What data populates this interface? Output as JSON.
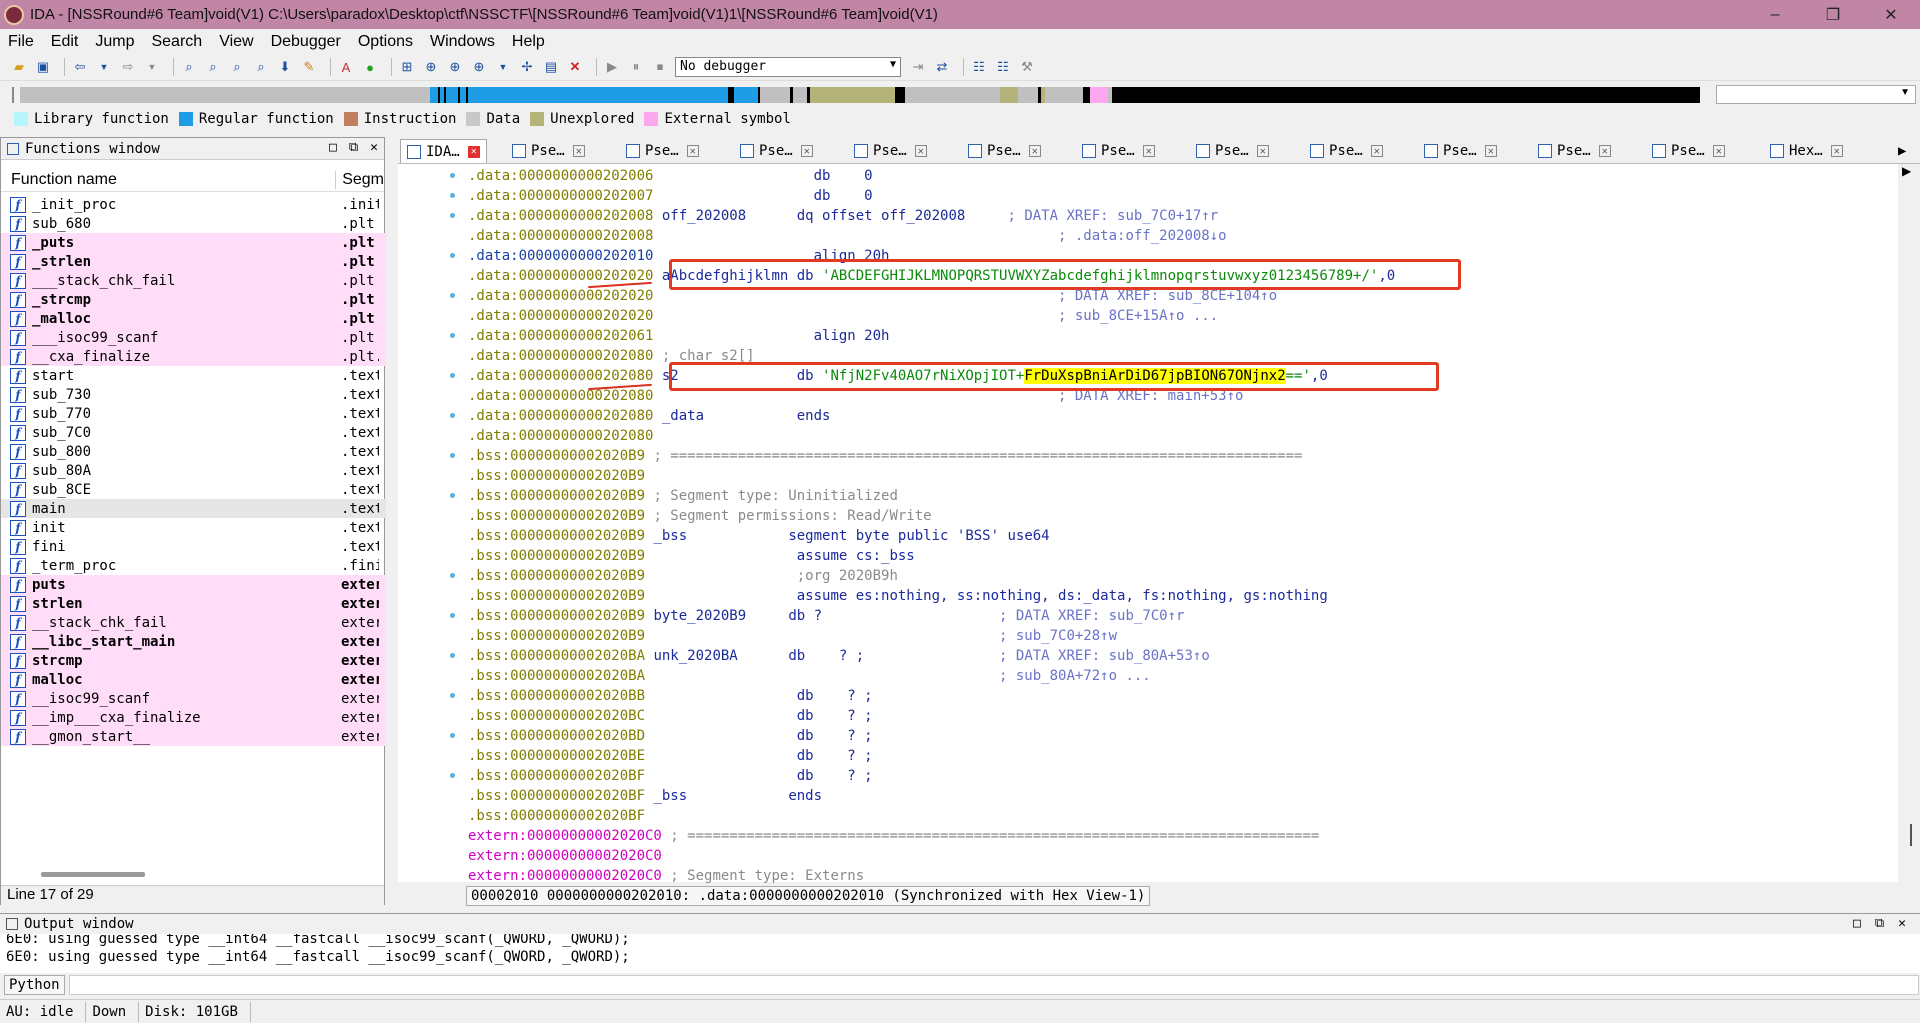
{
  "window": {
    "title": "IDA - [NSSRound#6 Team]void(V1) C:\\Users\\paradox\\Desktop\\ctf\\NSSCTF\\[NSSRound#6 Team]void(V1)1\\[NSSRound#6 Team]void(V1)",
    "controls": [
      "–",
      "❐",
      "✕"
    ]
  },
  "menu": [
    "File",
    "Edit",
    "Jump",
    "Search",
    "View",
    "Debugger",
    "Options",
    "Windows",
    "Help"
  ],
  "toolbar": {
    "debugger_value": "No debugger"
  },
  "legend": [
    {
      "label": "Library function",
      "color": "#b8f4fc"
    },
    {
      "label": "Regular function",
      "color": "#1e9de6"
    },
    {
      "label": "Instruction",
      "color": "#c08060"
    },
    {
      "label": "Data",
      "color": "#c8c8c8"
    },
    {
      "label": "Unexplored",
      "color": "#b4b47a"
    },
    {
      "label": "External symbol",
      "color": "#fca8f0"
    }
  ],
  "functions_window": {
    "title": "Functions window",
    "col_name": "Function name",
    "col_segment": "Segm",
    "line_info": "Line 17 of 29",
    "items": [
      {
        "name": "_init_proc",
        "seg": ".init",
        "style": ""
      },
      {
        "name": "sub_680",
        "seg": ".plt",
        "style": ""
      },
      {
        "name": "_puts",
        "seg": ".plt",
        "style": "ext bold"
      },
      {
        "name": "_strlen",
        "seg": ".plt",
        "style": "ext bold"
      },
      {
        "name": "___stack_chk_fail",
        "seg": ".plt",
        "style": "ext"
      },
      {
        "name": "_strcmp",
        "seg": ".plt",
        "style": "ext bold"
      },
      {
        "name": "_malloc",
        "seg": ".plt",
        "style": "ext bold"
      },
      {
        "name": "___isoc99_scanf",
        "seg": ".plt",
        "style": "ext"
      },
      {
        "name": "__cxa_finalize",
        "seg": ".plt.",
        "style": "ext"
      },
      {
        "name": "start",
        "seg": ".text",
        "style": ""
      },
      {
        "name": "sub_730",
        "seg": ".text",
        "style": ""
      },
      {
        "name": "sub_770",
        "seg": ".text",
        "style": ""
      },
      {
        "name": "sub_7C0",
        "seg": ".text",
        "style": ""
      },
      {
        "name": "sub_800",
        "seg": ".text",
        "style": ""
      },
      {
        "name": "sub_80A",
        "seg": ".text",
        "style": ""
      },
      {
        "name": "sub_8CE",
        "seg": ".text",
        "style": ""
      },
      {
        "name": "main",
        "seg": ".text",
        "style": "sel"
      },
      {
        "name": "init",
        "seg": ".text",
        "style": ""
      },
      {
        "name": "fini",
        "seg": ".text",
        "style": ""
      },
      {
        "name": "_term_proc",
        "seg": ".fini",
        "style": ""
      },
      {
        "name": "puts",
        "seg": "exter",
        "style": "ext bold"
      },
      {
        "name": "strlen",
        "seg": "exter",
        "style": "ext bold"
      },
      {
        "name": "__stack_chk_fail",
        "seg": "exter",
        "style": "ext"
      },
      {
        "name": "__libc_start_main",
        "seg": "exter",
        "style": "ext bold"
      },
      {
        "name": "strcmp",
        "seg": "exter",
        "style": "ext bold"
      },
      {
        "name": "malloc",
        "seg": "exter",
        "style": "ext bold"
      },
      {
        "name": "__isoc99_scanf",
        "seg": "exter",
        "style": "ext"
      },
      {
        "name": "__imp___cxa_finalize",
        "seg": "exter",
        "style": "ext"
      },
      {
        "name": "__gmon_start__",
        "seg": "exter",
        "style": "ext"
      }
    ]
  },
  "tabs": [
    "IDA…",
    "Pse…",
    "Pse…",
    "Pse…",
    "Pse…",
    "Pse…",
    "Pse…",
    "Pse…",
    "Pse…",
    "Pse…",
    "Pse…",
    "Pse…",
    "Hex…"
  ],
  "code_lines": [
    {
      "addr": ".data:0000000000202006",
      "seg": "data",
      "parts": [
        [
          "",
          "                   "
        ],
        [
          "kw",
          "db    0"
        ]
      ]
    },
    {
      "addr": ".data:0000000000202007",
      "seg": "data",
      "parts": [
        [
          "",
          "                   "
        ],
        [
          "kw",
          "db    0"
        ]
      ]
    },
    {
      "addr": ".data:0000000000202008",
      "seg": "data",
      "parts": [
        [
          "nm",
          " off_202008      "
        ],
        [
          "kw",
          "dq offset off_202008"
        ],
        [
          "cm",
          "     ; DATA XREF: sub_7C0+17↑r"
        ]
      ]
    },
    {
      "addr": ".data:0000000000202008",
      "seg": "data",
      "parts": [
        [
          "cm",
          "                                                ; .data:off_202008↓o"
        ]
      ]
    },
    {
      "addr": ".data:0000000000202010",
      "seg": "datahi",
      "parts": [
        [
          "",
          "                   "
        ],
        [
          "kw",
          "align 20h"
        ]
      ]
    },
    {
      "addr": ".data:0000000000202020",
      "seg": "data",
      "parts": [
        [
          "nm",
          " aAbcdefghijklmn "
        ],
        [
          "kw",
          "db "
        ],
        [
          "str",
          "'ABCDEFGHIJKLMNOPQRSTUVWXYZabcdefghijklmnopqrstuvwxyz0123456789+/'"
        ],
        [
          "kw",
          ",0"
        ]
      ]
    },
    {
      "addr": ".data:0000000000202020",
      "seg": "data",
      "parts": [
        [
          "cm",
          "                                                ; DATA XREF: sub_8CE+104↑o"
        ]
      ]
    },
    {
      "addr": ".data:0000000000202020",
      "seg": "data",
      "parts": [
        [
          "cm",
          "                                                ; sub_8CE+15A↑o ..."
        ]
      ]
    },
    {
      "addr": ".data:0000000000202061",
      "seg": "data",
      "parts": [
        [
          "",
          "                   "
        ],
        [
          "kw",
          "align 20h"
        ]
      ]
    },
    {
      "addr": ".data:0000000000202080",
      "seg": "data",
      "parts": [
        [
          "gr",
          " ; char s2[]"
        ]
      ]
    },
    {
      "addr": ".data:0000000000202080",
      "seg": "data",
      "parts": [
        [
          "nm",
          " s2              "
        ],
        [
          "kw",
          "db "
        ],
        [
          "str",
          "'NfjN2Fv40AO7rNiXOpjIOT+"
        ],
        [
          "hl",
          "FrDuXspBniArDiD67jpBION67ONjnx2"
        ],
        [
          "str",
          "=='"
        ],
        [
          "kw",
          ",0"
        ]
      ]
    },
    {
      "addr": ".data:0000000000202080",
      "seg": "data",
      "parts": [
        [
          "cm",
          "                                                ; DATA XREF: main+53↑o"
        ]
      ]
    },
    {
      "addr": ".data:0000000000202080",
      "seg": "data",
      "parts": [
        [
          "nm",
          " _data           "
        ],
        [
          "kw",
          "ends"
        ]
      ]
    },
    {
      "addr": ".data:0000000000202080",
      "seg": "data",
      "parts": []
    },
    {
      "addr": ".bss:00000000002020B9",
      "seg": "data",
      "parts": [
        [
          "gr",
          " ; ==========================================================================="
        ]
      ]
    },
    {
      "addr": ".bss:00000000002020B9",
      "seg": "data",
      "parts": []
    },
    {
      "addr": ".bss:00000000002020B9",
      "seg": "data",
      "parts": [
        [
          "gr",
          " ; Segment type: Uninitialized"
        ]
      ]
    },
    {
      "addr": ".bss:00000000002020B9",
      "seg": "data",
      "parts": [
        [
          "gr",
          " ; Segment permissions: Read/Write"
        ]
      ]
    },
    {
      "addr": ".bss:00000000002020B9",
      "seg": "data",
      "parts": [
        [
          "nm",
          " _bss            "
        ],
        [
          "kw",
          "segment byte public 'BSS' use64"
        ]
      ]
    },
    {
      "addr": ".bss:00000000002020B9",
      "seg": "data",
      "parts": [
        [
          "",
          "                  "
        ],
        [
          "kw",
          "assume cs:_bss"
        ]
      ]
    },
    {
      "addr": ".bss:00000000002020B9",
      "seg": "data",
      "parts": [
        [
          "gr",
          "                  ;org 2020B9h"
        ]
      ]
    },
    {
      "addr": ".bss:00000000002020B9",
      "seg": "data",
      "parts": [
        [
          "",
          "                  "
        ],
        [
          "kw",
          "assume es:nothing, ss:nothing, ds:_data, fs:nothing, gs:nothing"
        ]
      ]
    },
    {
      "addr": ".bss:00000000002020B9",
      "seg": "data",
      "parts": [
        [
          "nm",
          " byte_2020B9     "
        ],
        [
          "kw",
          "db ?"
        ],
        [
          "cm",
          "                     ; DATA XREF: sub_7C0↑r"
        ]
      ]
    },
    {
      "addr": ".bss:00000000002020B9",
      "seg": "data",
      "parts": [
        [
          "cm",
          "                                          ; sub_7C0+28↑w"
        ]
      ]
    },
    {
      "addr": ".bss:00000000002020BA",
      "seg": "data",
      "parts": [
        [
          "nm",
          " unk_2020BA      "
        ],
        [
          "kw",
          "db    ? ;"
        ],
        [
          "cm",
          "                ; DATA XREF: sub_80A+53↑o"
        ]
      ]
    },
    {
      "addr": ".bss:00000000002020BA",
      "seg": "data",
      "parts": [
        [
          "cm",
          "                                          ; sub_80A+72↑o ..."
        ]
      ]
    },
    {
      "addr": ".bss:00000000002020BB",
      "seg": "data",
      "parts": [
        [
          "",
          "                  "
        ],
        [
          "kw",
          "db    ? ;"
        ]
      ]
    },
    {
      "addr": ".bss:00000000002020BC",
      "seg": "data",
      "parts": [
        [
          "",
          "                  "
        ],
        [
          "kw",
          "db    ? ;"
        ]
      ]
    },
    {
      "addr": ".bss:00000000002020BD",
      "seg": "data",
      "parts": [
        [
          "",
          "                  "
        ],
        [
          "kw",
          "db    ? ;"
        ]
      ]
    },
    {
      "addr": ".bss:00000000002020BE",
      "seg": "data",
      "parts": [
        [
          "",
          "                  "
        ],
        [
          "kw",
          "db    ? ;"
        ]
      ]
    },
    {
      "addr": ".bss:00000000002020BF",
      "seg": "data",
      "parts": [
        [
          "",
          "                  "
        ],
        [
          "kw",
          "db    ? ;"
        ]
      ]
    },
    {
      "addr": ".bss:00000000002020BF",
      "seg": "data",
      "parts": [
        [
          "nm",
          " _bss            "
        ],
        [
          "kw",
          "ends"
        ]
      ]
    },
    {
      "addr": ".bss:00000000002020BF",
      "seg": "data",
      "parts": []
    },
    {
      "addr": "extern:00000000002020C0",
      "seg": "ext",
      "parts": [
        [
          "gr",
          " ; ==========================================================================="
        ]
      ]
    },
    {
      "addr": "extern:00000000002020C0",
      "seg": "ext",
      "parts": []
    },
    {
      "addr": "extern:00000000002020C0",
      "seg": "ext",
      "parts": [
        [
          "gr",
          " ; Segment type: Externs"
        ]
      ]
    }
  ],
  "sync_status": "00002010 0000000000202010: .data:0000000000202010 (Synchronized with Hex View-1)",
  "output_window": {
    "title": "Output window",
    "lines": [
      "6E0: using guessed type __int64 __fastcall __isoc99_scanf(_QWORD, _QWORD);",
      "6E0: using guessed type __int64 __fastcall __isoc99_scanf(_QWORD, _QWORD);"
    ]
  },
  "python_button": "Python",
  "statusbar": [
    "AU:  idle",
    "Down",
    "Disk: 101GB"
  ]
}
